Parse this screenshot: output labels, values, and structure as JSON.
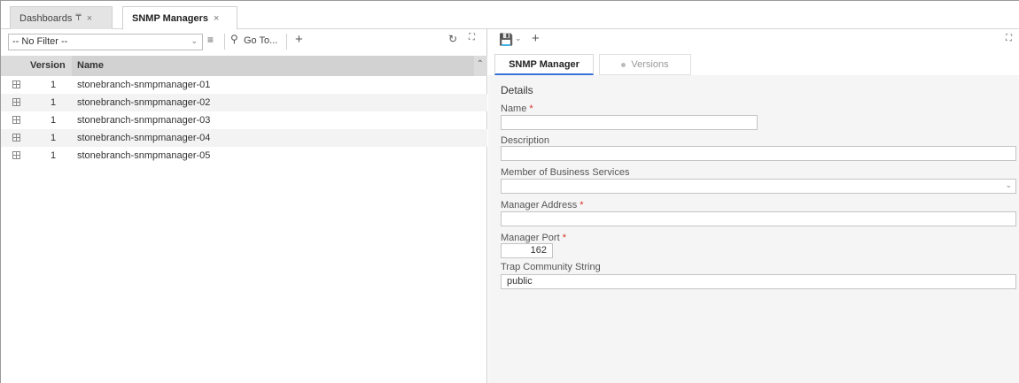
{
  "tabs": [
    {
      "label": "Dashboards",
      "pinned_icon": "pin-icon",
      "close": "×"
    },
    {
      "label": "SNMP Managers",
      "close": "×"
    }
  ],
  "left": {
    "filter": {
      "value": "-- No Filter --"
    },
    "goto_label": "Go To...",
    "columns": {
      "version": "Version",
      "name": "Name"
    },
    "rows": [
      {
        "version": "1",
        "name": "stonebranch-snmpmanager-01"
      },
      {
        "version": "1",
        "name": "stonebranch-snmpmanager-02"
      },
      {
        "version": "1",
        "name": "stonebranch-snmpmanager-03"
      },
      {
        "version": "1",
        "name": "stonebranch-snmpmanager-04"
      },
      {
        "version": "1",
        "name": "stonebranch-snmpmanager-05"
      }
    ]
  },
  "right": {
    "subtabs": {
      "manager": "SNMP Manager",
      "versions": "Versions"
    },
    "details_title": "Details",
    "fields": {
      "name": {
        "label": "Name",
        "value": ""
      },
      "description": {
        "label": "Description",
        "value": ""
      },
      "business_services": {
        "label": "Member of Business Services",
        "value": ""
      },
      "manager_address": {
        "label": "Manager Address",
        "value": ""
      },
      "manager_port": {
        "label": "Manager Port",
        "value": "162"
      },
      "trap_community": {
        "label": "Trap Community String",
        "value": "public"
      }
    }
  },
  "colors": {
    "accent": "#3b73d9",
    "required": "#d93025",
    "header_bg": "#dcdcdc"
  }
}
